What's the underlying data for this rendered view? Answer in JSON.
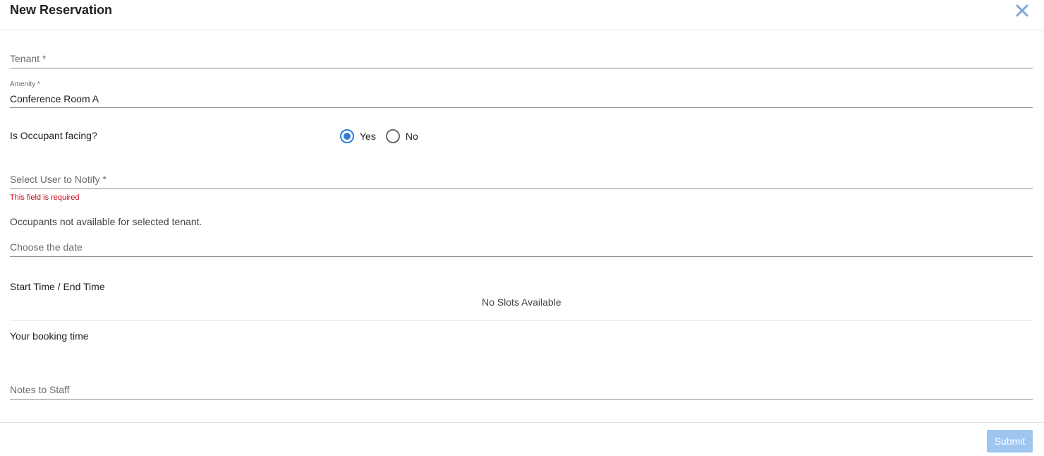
{
  "dialog": {
    "title": "New Reservation",
    "close_icon": "close-icon"
  },
  "form": {
    "tenant": {
      "placeholder": "Tenant *",
      "value": ""
    },
    "amenity": {
      "label": "Amenity *",
      "value": "Conference Room A"
    },
    "occupant_facing": {
      "label": "Is Occupant facing?",
      "options": [
        {
          "label": "Yes",
          "checked": true
        },
        {
          "label": "No",
          "checked": false
        }
      ]
    },
    "notify_user": {
      "placeholder": "Select User to Notify *",
      "error": "This field is required"
    },
    "occupants_message": "Occupants not available for selected tenant.",
    "date": {
      "placeholder": "Choose the date"
    },
    "time": {
      "label": "Start Time / End Time",
      "empty_message": "No Slots Available"
    },
    "booking_time": {
      "label": "Your booking time"
    },
    "notes": {
      "placeholder": "Notes to Staff"
    }
  },
  "footer": {
    "submit_label": "Submit"
  },
  "colors": {
    "accent": "#2d7fd6",
    "error": "#d0021b",
    "submit_disabled": "#9ec6ef",
    "close_icon": "#7fa9d6"
  }
}
